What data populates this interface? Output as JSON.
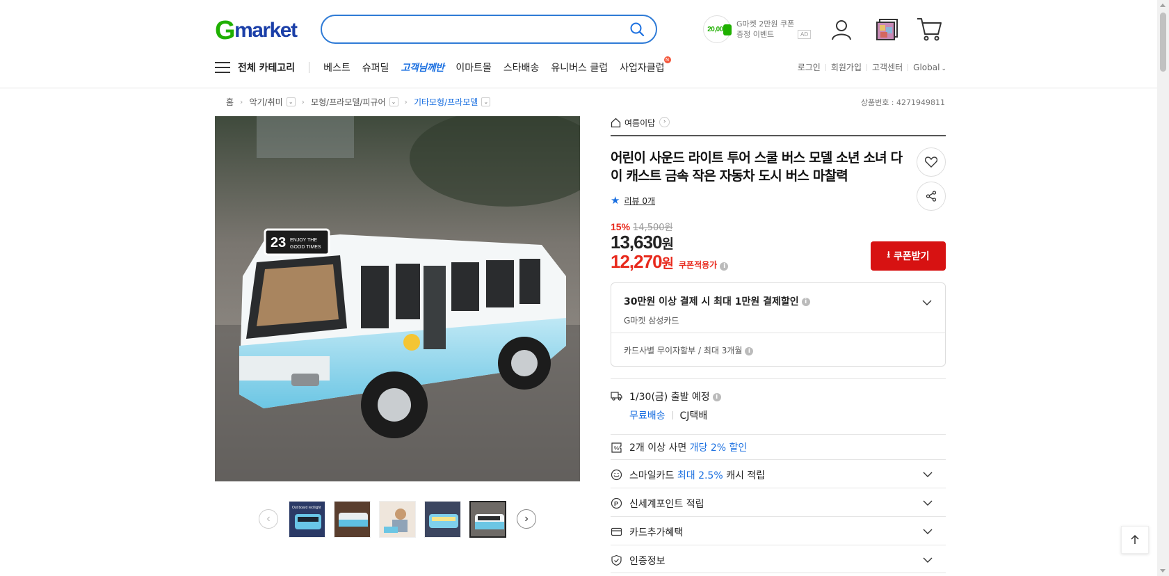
{
  "header": {
    "logo": {
      "g": "G",
      "rest": "market"
    },
    "search": {
      "value": "",
      "placeholder": ""
    },
    "ad": {
      "coin": "20,000",
      "line1": "G마켓 2만원 쿠폰",
      "line2": "증정 이벤트",
      "badge": "AD"
    }
  },
  "gnb": {
    "all_category": "전체 카테고리",
    "items": [
      "베스트",
      "슈퍼딜",
      "고객님께반",
      "이마트몰",
      "스타배송",
      "유니버스 클럽",
      "사업자클럽"
    ],
    "new_badge": "N"
  },
  "util": {
    "login": "로그인",
    "signup": "회원가입",
    "support": "고객센터",
    "global": "Global"
  },
  "breadcrumb": {
    "home": "홈",
    "level1": "악기/취미",
    "level2": "모형/프라모델/피규어",
    "level3": "기타모형/프라모델"
  },
  "product_number": "상품번호 : 4271949811",
  "gallery": {
    "bus_sign": "23",
    "bus_sign_text1": "ENJOY THE",
    "bus_sign_text2": "GOOD TIMES",
    "thumb_caption": "Out board red light"
  },
  "product": {
    "shop": "여름이담",
    "title": "어린이 사운드 라이트 투어 스쿨 버스 모델 소년 소녀 다이 캐스트 금속 작은 자동차 도시 버스 마찰력",
    "review": "리뷰 0개",
    "discount_rate": "15%",
    "original_price": "14,500원",
    "price": "13,630",
    "price_unit": "원",
    "coupon_price": "12,270",
    "coupon_label": "쿠폰적용가",
    "coupon_button": "쿠폰받기"
  },
  "card_benefit": {
    "main": "30만원 이상 결제 시 최대 1만원 결제할인",
    "sub": "G마켓 삼성카드",
    "installment": "카드사별 무이자할부 / 최대 3개월"
  },
  "shipping": {
    "date": "1/30(금) 출발 예정",
    "fee": "무료배송",
    "carrier": "CJ택배"
  },
  "benefits": {
    "multi": {
      "prefix": "2개 이상 사면 ",
      "highlight": "개당 2% 할인"
    },
    "smile": {
      "prefix": "스마일카드 ",
      "highlight": "최대 2.5%",
      "suffix": " 캐시 적립"
    },
    "point": "신세계포인트 적립",
    "card_extra": "카드추가혜택",
    "cert": "인증정보"
  },
  "colors": {
    "brand_green": "#1fb000",
    "brand_blue": "#1b3fa8",
    "accent_red": "#d71212",
    "link_blue": "#1a6fe0"
  }
}
